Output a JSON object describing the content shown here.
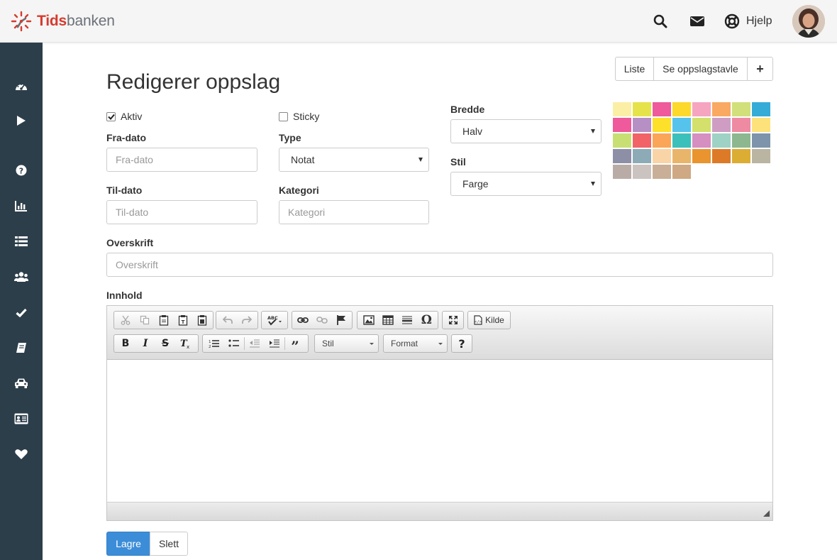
{
  "brand": {
    "name_part1": "Tids",
    "name_part2": "banken",
    "accent": "#d63a2f"
  },
  "topnav": {
    "help_label": "Hjelp"
  },
  "sidebar": {
    "items": [
      {
        "icon": "dashboard-icon"
      },
      {
        "icon": "play-icon"
      },
      {
        "icon": "question-icon"
      },
      {
        "icon": "bar-chart-icon"
      },
      {
        "icon": "list-icon"
      },
      {
        "icon": "users-icon"
      },
      {
        "icon": "check-icon"
      },
      {
        "icon": "book-icon"
      },
      {
        "icon": "car-icon"
      },
      {
        "icon": "id-card-icon"
      },
      {
        "icon": "heart-icon"
      }
    ]
  },
  "page": {
    "title": "Redigerer oppslag"
  },
  "top_buttons": {
    "list": "Liste",
    "board": "Se oppslagstavle",
    "add": "+"
  },
  "form": {
    "active_label": "Aktiv",
    "active_checked": true,
    "sticky_label": "Sticky",
    "sticky_checked": false,
    "from_label": "Fra-dato",
    "from_placeholder": "Fra-dato",
    "to_label": "Til-dato",
    "to_placeholder": "Til-dato",
    "type_label": "Type",
    "type_value": "Notat",
    "category_label": "Kategori",
    "category_placeholder": "Kategori",
    "width_label": "Bredde",
    "width_value": "Halv",
    "style_label": "Stil",
    "style_value": "Farge",
    "heading_label": "Overskrift",
    "heading_placeholder": "Overskrift",
    "content_label": "Innhold"
  },
  "palette": [
    "#fbefa6",
    "#e5e349",
    "#ee5a9b",
    "#fcd92b",
    "#f6a5c0",
    "#f9a961",
    "#d1e07a",
    "#35acd8",
    "#ee5a9b",
    "#b68fc5",
    "#fde02a",
    "#56c3ec",
    "#d3e06b",
    "#cf9dc4",
    "#ee8aa2",
    "#fde27b",
    "#c8df73",
    "#f16367",
    "#faa557",
    "#3cc0bc",
    "#d58fc0",
    "#9ed2c5",
    "#8db78f",
    "#7d94ab",
    "#8d8fa6",
    "#8cabb6",
    "#f9d4a6",
    "#e9b56b",
    "#e9942f",
    "#dd7a28",
    "#dbad33",
    "#b9b5a2",
    "#b9aca6",
    "#cac3bf",
    "#c9af97",
    "#cea983"
  ],
  "editor": {
    "source_label": "Kilde",
    "style_combo": "Stil",
    "format_combo": "Format"
  },
  "actions": {
    "save": "Lagre",
    "delete": "Slett"
  }
}
